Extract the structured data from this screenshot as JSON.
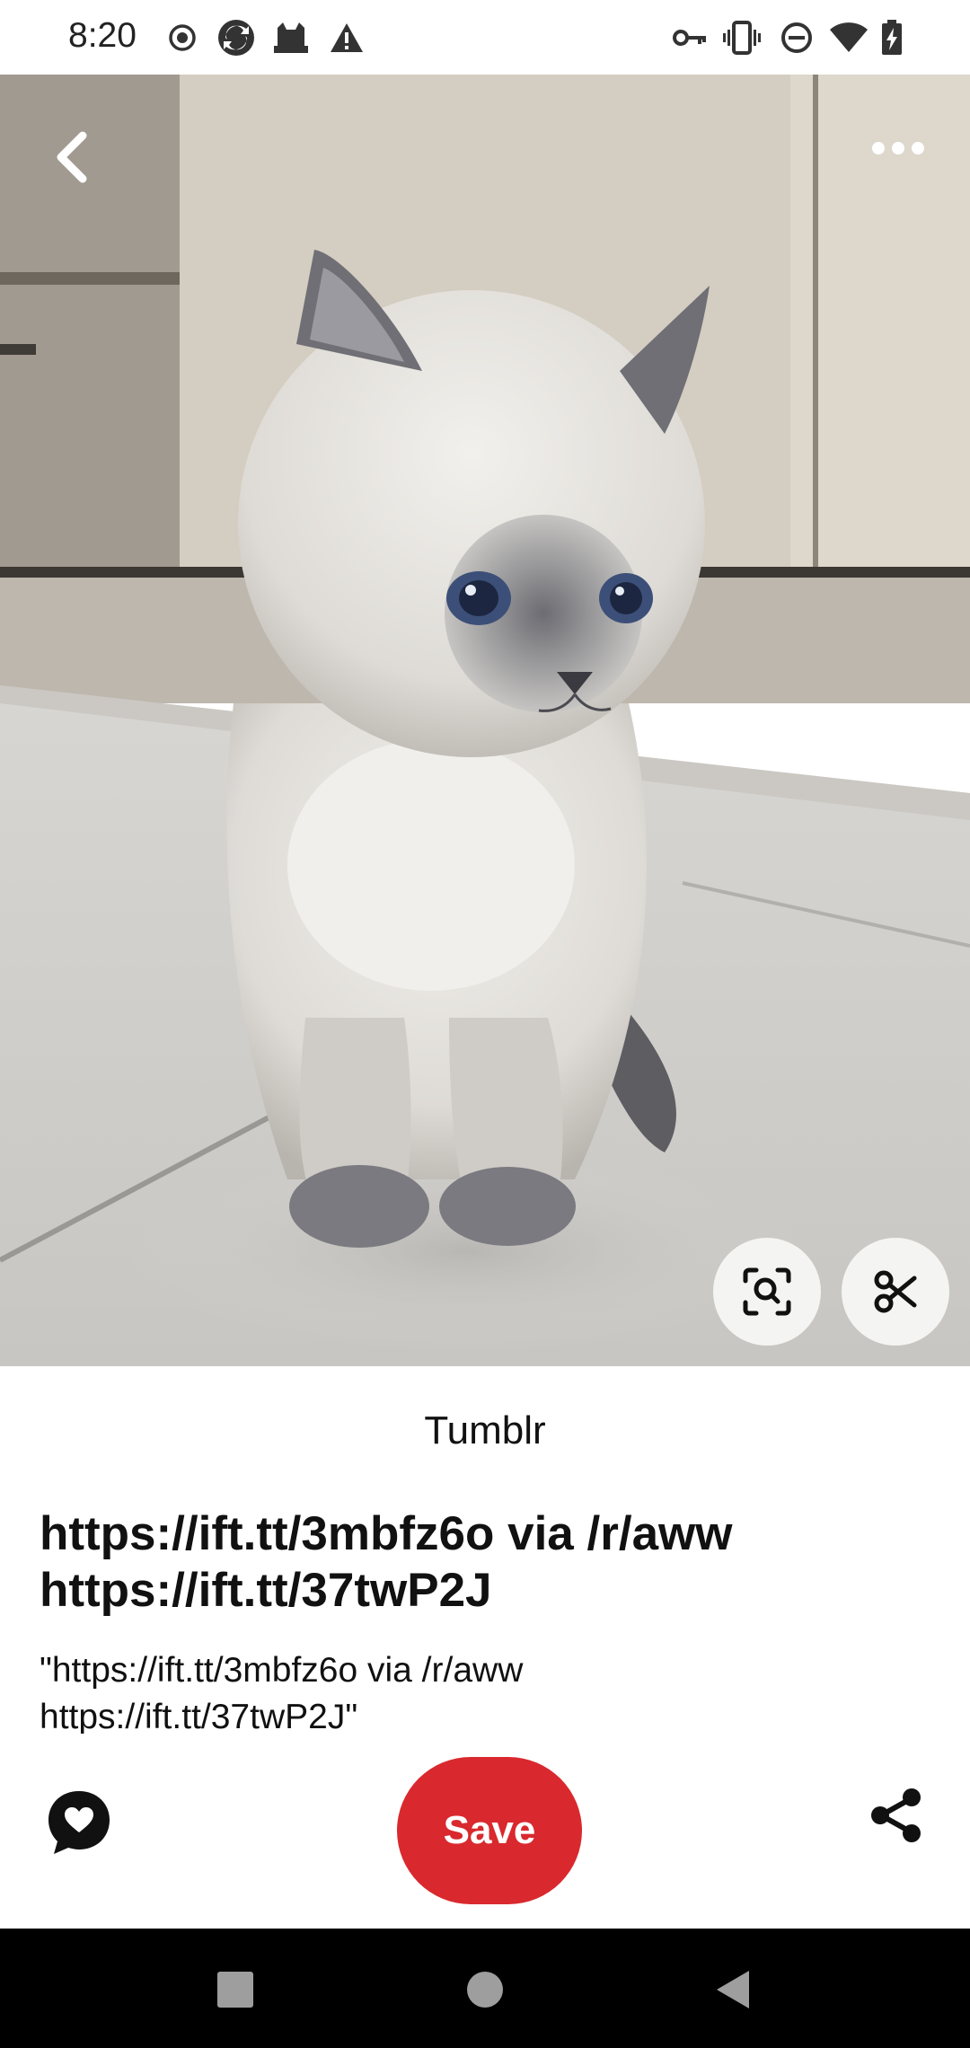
{
  "status_bar": {
    "time": "8:20",
    "left_icons": [
      "record-icon",
      "sync-icon",
      "cat-notification-icon",
      "warning-icon"
    ],
    "right_icons": [
      "key-icon",
      "vibrate-icon",
      "do-not-disturb-icon",
      "wifi-icon",
      "battery-charging-icon"
    ]
  },
  "pin": {
    "image_subject": "kitten photo",
    "source": "Tumblr",
    "title_lines": [
      "https://ift.tt/3mbfz6o via /r/aww",
      "https://ift.tt/37twP2J"
    ],
    "description_lines": [
      "\"https://ift.tt/3mbfz6o via /r/aww",
      "https://ift.tt/37twP2J\""
    ]
  },
  "toolbar": {
    "back_icon": "chevron-left-icon",
    "more_icon": "more-horizontal-icon",
    "visual_search_icon": "lens-search-icon",
    "crop_icon": "scissors-icon"
  },
  "actions": {
    "comment_icon": "comment-heart-icon",
    "save_label": "Save",
    "share_icon": "share-icon",
    "save_color": "#d9292e"
  },
  "nav_bar": {
    "icons": [
      "recents-square-icon",
      "home-circle-icon",
      "back-triangle-icon"
    ]
  }
}
